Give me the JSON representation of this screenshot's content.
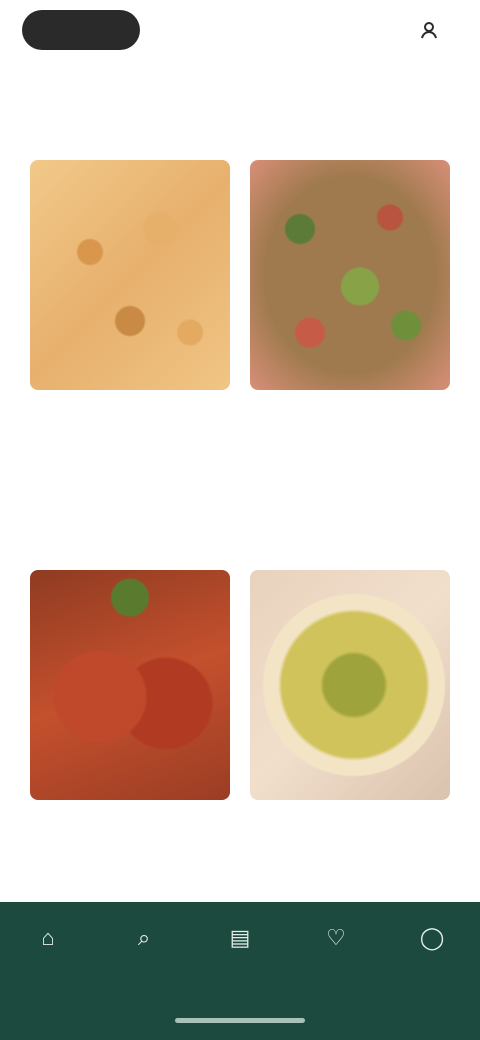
{
  "header": {
    "logo": "",
    "right_label": ""
  },
  "page": {
    "title": "",
    "subtitle": ""
  },
  "recipes": [
    {
      "tag": "",
      "time": "",
      "title": "",
      "image": "baked-pasta-image"
    },
    {
      "tag": "",
      "time": "",
      "title": "",
      "image": "salad-image"
    },
    {
      "tag": "",
      "time": "",
      "title": "",
      "image": "stuffed-pepper-image"
    },
    {
      "tag": "",
      "time": "",
      "title": "",
      "image": "bowl-image"
    }
  ],
  "nav": {
    "items": [
      {
        "icon": "home-icon",
        "label": ""
      },
      {
        "icon": "search-icon",
        "label": ""
      },
      {
        "icon": "book-icon",
        "label": ""
      },
      {
        "icon": "heart-icon",
        "label": ""
      },
      {
        "icon": "user-icon",
        "label": ""
      }
    ]
  },
  "colors": {
    "brand_green": "#1d4a3f",
    "title_green": "#1f4c40",
    "tag_green": "#3f8a52"
  }
}
